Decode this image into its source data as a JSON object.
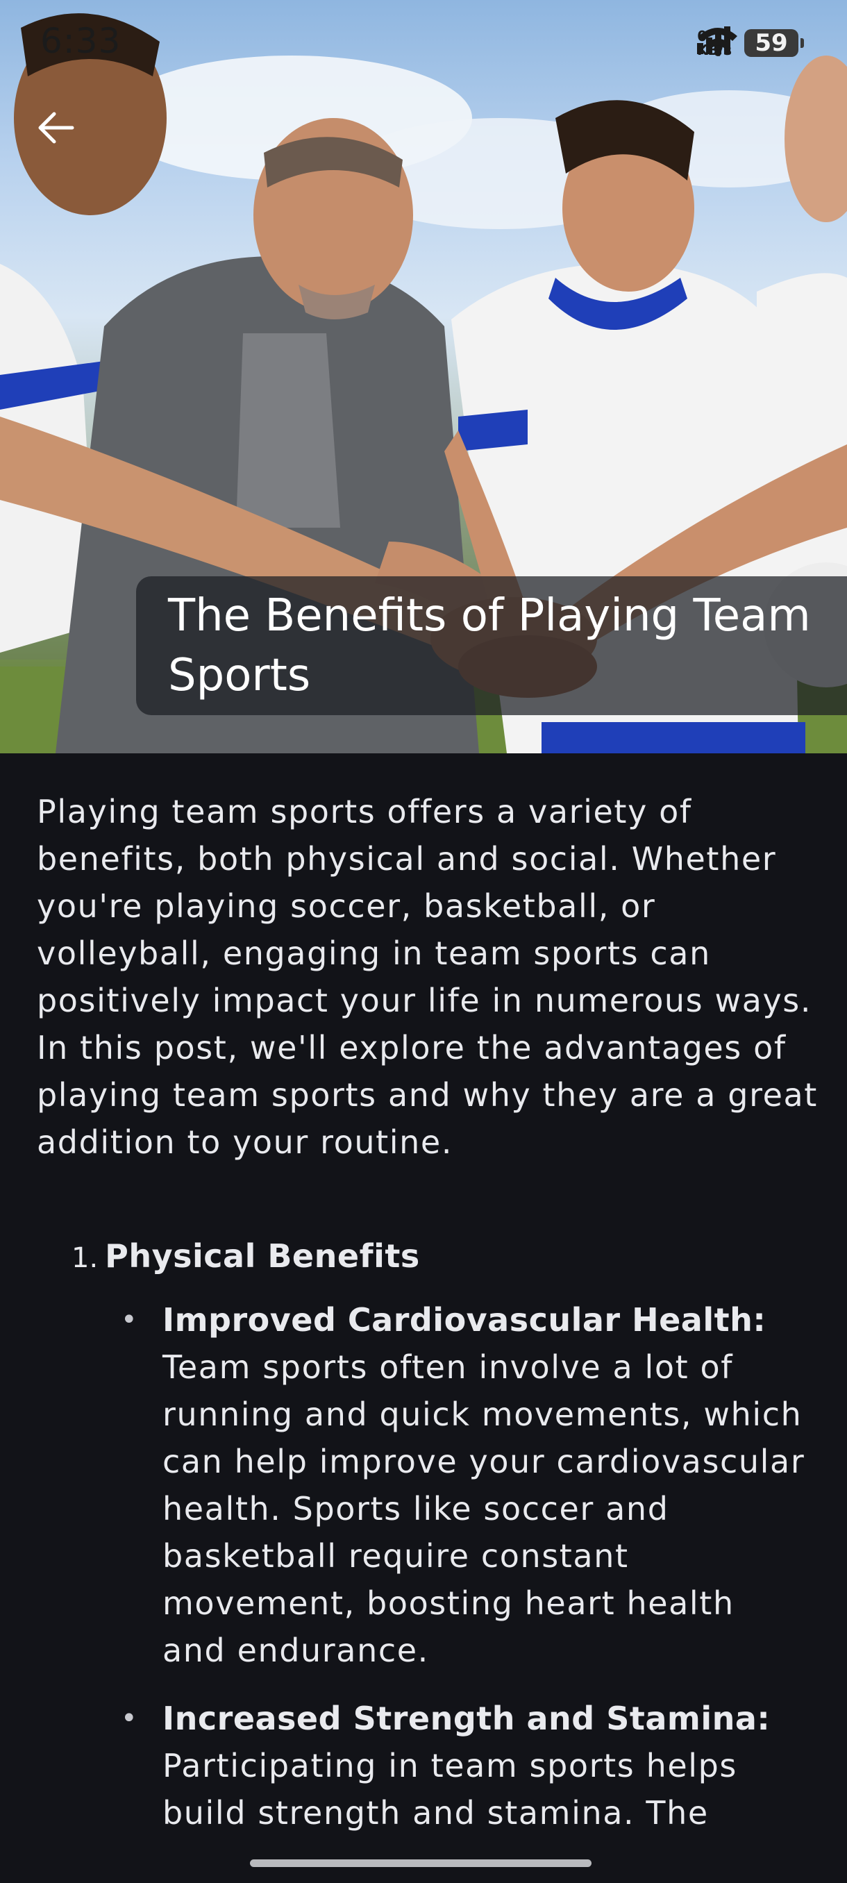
{
  "status_bar": {
    "time": "6:33",
    "net_speed_value": "0.17",
    "net_speed_unit": "KB/s",
    "battery": "59"
  },
  "hero": {
    "image_subject": "team-sports-hands-together-photo",
    "title": "The Benefits of Playing Team Sports"
  },
  "article": {
    "intro": "Playing team sports offers a variety of benefits, both physical and social. Whether you're playing soccer, basketball, or volleyball, engaging in team sports can positively impact your life in numerous ways. In this post, we'll explore the advantages of playing team sports and why they are a great addition to your routine.",
    "sections": [
      {
        "number": "1.",
        "heading": "Physical Benefits",
        "bullets": [
          {
            "marker": "•",
            "head": "Improved Cardiovascular Health:",
            "text": "Team sports often involve a lot of running and quick movements, which can help improve your cardiovascular health. Sports like soccer and basketball require constant movement, boosting heart health and endurance."
          },
          {
            "marker": "•",
            "head": "Increased Strength and Stamina:",
            "text": "Participating in team sports helps build strength and stamina. The"
          }
        ]
      }
    ]
  },
  "colors": {
    "background": "#121318",
    "text": "#e9eaee",
    "title_overlay": "#1c1e24",
    "jersey_blue": "#1f3fb8"
  },
  "icons": {
    "back": "arrow-left-icon",
    "signal": "signal-bars-icon",
    "wifi": "wifi-icon",
    "battery": "battery-icon"
  }
}
